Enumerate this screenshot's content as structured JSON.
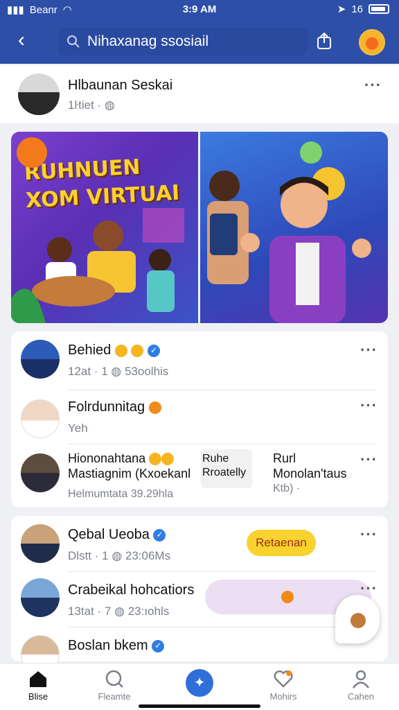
{
  "status": {
    "carrier": "Beanr",
    "time": "3:9 AM",
    "battery": "16"
  },
  "header": {
    "search_value": "Nihaxanag ssosiail"
  },
  "profile": {
    "name": "Hlbaunan Seskai",
    "meta": "1ŀtiet"
  },
  "collage": {
    "banner_line1": "RUHNUEN",
    "banner_line2": "XOM VIRTUAI"
  },
  "posts": [
    {
      "name": "Behied",
      "meta": "12at · 1",
      "extra": "53oolhis"
    },
    {
      "name": "Folrdunnitag",
      "meta": "Yeh"
    },
    {
      "name": "Hiononahtana",
      "name2": "Mastiagnim (Kxoekanl",
      "meta": "Helmumtata 39.29hla",
      "tag1": "Ruhe",
      "tag2": "Rroatelly",
      "side1": "Rurl",
      "side2": "Monolan'taus",
      "side3": "Ktb) ·"
    },
    {
      "name": "Qebal Ueoba",
      "meta": "Dlstt · 1",
      "extra": "23:06Ms",
      "action": "Retaenan"
    },
    {
      "name": "Crabeikal hohcatiors",
      "meta": "13tat · 7",
      "extra": "23:ıohls"
    },
    {
      "name": "Boslan bkem",
      "meta": ""
    }
  ],
  "tabs": [
    "Blise",
    "Fleamte",
    "Mohirs",
    "Cahen"
  ],
  "colors": {
    "brand": "#2d4fa8",
    "accent_yellow": "#f8d22e",
    "verified": "#2f7de1"
  }
}
